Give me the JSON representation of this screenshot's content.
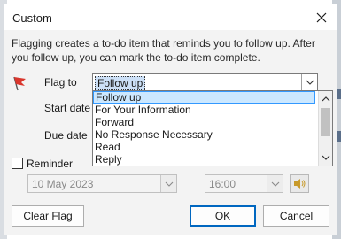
{
  "dialog": {
    "title": "Custom",
    "description": "Flagging creates a to-do item that reminds you to follow up. After you follow up, you can mark the to-do item complete.",
    "flag_to_label": "Flag to",
    "flag_to_value": "Follow up",
    "start_date_label": "Start date",
    "due_date_label": "Due date",
    "reminder_label": "Reminder",
    "reminder_checked": false,
    "reminder_date": "10 May 2023",
    "reminder_time": "16:00",
    "dropdown_options": [
      "Follow up",
      "For Your Information",
      "Forward",
      "No Response Necessary",
      "Read",
      "Reply"
    ],
    "selected_option": "Follow up",
    "buttons": {
      "clear_flag": "Clear Flag",
      "ok": "OK",
      "cancel": "Cancel"
    }
  },
  "colors": {
    "selection": "#cce8ff",
    "selection_border": "#3399ff",
    "default_button_border": "#0067c0",
    "flag": "#d9362c"
  },
  "icons": [
    "close-icon",
    "flag-icon",
    "chevron-down-icon",
    "chevron-up-icon",
    "speaker-icon"
  ]
}
